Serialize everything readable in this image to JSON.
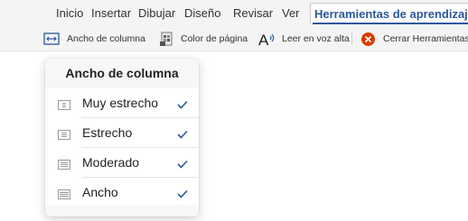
{
  "ribbon": {
    "tabs": [
      {
        "label": "Inicio"
      },
      {
        "label": "Insertar"
      },
      {
        "label": "Dibujar"
      },
      {
        "label": "Diseño"
      },
      {
        "label": "Revisar"
      },
      {
        "label": "Ver"
      },
      {
        "label": "Herramientas de aprendizaje",
        "active": true
      }
    ]
  },
  "toolbar": {
    "column_width_label": "Ancho de columna",
    "page_color_label": "Color de página",
    "read_aloud_label": "Leer en voz alta",
    "close_label": "Cerrar Herramientas",
    "icons": {
      "column_width": "column-width-icon",
      "page_color": "page-color-icon",
      "read_aloud": "read-aloud-icon",
      "close": "close-circle-icon"
    },
    "close_color": "#d83b01"
  },
  "dropdown": {
    "title": "Ancho de columna",
    "items": [
      {
        "label": "Muy estrecho",
        "checked": true
      },
      {
        "label": "Estrecho",
        "checked": true
      },
      {
        "label": "Moderado",
        "checked": true
      },
      {
        "label": "Ancho",
        "checked": true
      }
    ],
    "check_color": "#2b579a"
  }
}
